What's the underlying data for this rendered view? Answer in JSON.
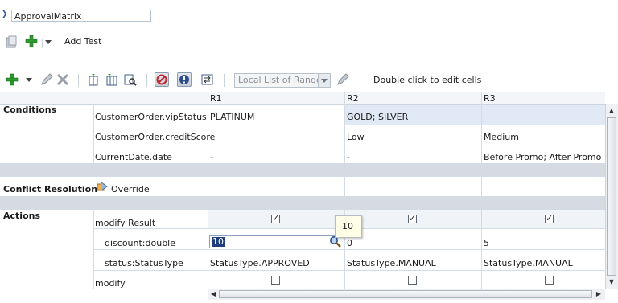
{
  "name_field": {
    "value": "ApprovalMatrix"
  },
  "test_bar": {
    "add_test_label": "Add Test"
  },
  "toolbar": {
    "range_select_value": "Local List of Ranges",
    "hint": "Double click to edit cells"
  },
  "grid": {
    "columns": [
      "R1",
      "R2",
      "R3"
    ],
    "sections": {
      "conditions": "Conditions",
      "conflict_resolution": "Conflict Resolution",
      "actions": "Actions"
    },
    "override_label": "Override",
    "rows": {
      "vip_status": {
        "label": "CustomerOrder.vipStatus",
        "r1": "PLATINUM",
        "r2": "GOLD; SILVER",
        "r3": ""
      },
      "credit_score": {
        "label": "CustomerOrder.creditScore",
        "r1": "-",
        "r2": "Low",
        "r3": "Medium"
      },
      "current_date": {
        "label": "CurrentDate.date",
        "r1": "-",
        "r2": "-",
        "r3": "Before Promo; After Promo"
      },
      "modify_result": {
        "label": "modify Result",
        "r1": true,
        "r2": true,
        "r3": true
      },
      "discount": {
        "label": "discount:double",
        "r1": "10",
        "r2": "0",
        "r3": "5"
      },
      "status": {
        "label": "status:StatusType",
        "r1": "StatusType.APPROVED",
        "r2": "StatusType.MANUAL",
        "r3": "StatusType.MANUAL"
      },
      "modify": {
        "label": "modify",
        "r1": false,
        "r2": false,
        "r3": false
      }
    },
    "tooltip_value": "10"
  }
}
